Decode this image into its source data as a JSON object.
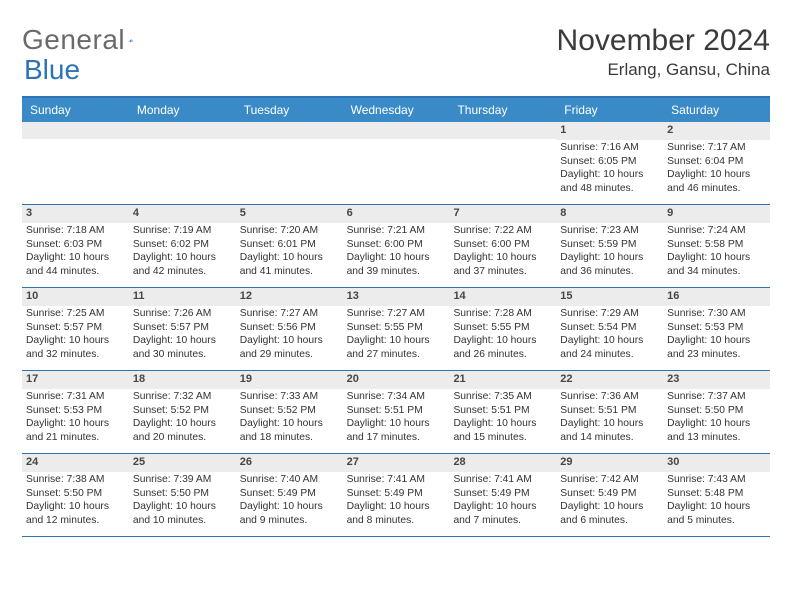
{
  "brand": {
    "part1": "General",
    "part2": "Blue"
  },
  "title": "November 2024",
  "location": "Erlang, Gansu, China",
  "weekdays": [
    "Sunday",
    "Monday",
    "Tuesday",
    "Wednesday",
    "Thursday",
    "Friday",
    "Saturday"
  ],
  "weeks": [
    [
      null,
      null,
      null,
      null,
      null,
      {
        "n": "1",
        "sr": "Sunrise: 7:16 AM",
        "ss": "Sunset: 6:05 PM",
        "dl1": "Daylight: 10 hours",
        "dl2": "and 48 minutes."
      },
      {
        "n": "2",
        "sr": "Sunrise: 7:17 AM",
        "ss": "Sunset: 6:04 PM",
        "dl1": "Daylight: 10 hours",
        "dl2": "and 46 minutes."
      }
    ],
    [
      {
        "n": "3",
        "sr": "Sunrise: 7:18 AM",
        "ss": "Sunset: 6:03 PM",
        "dl1": "Daylight: 10 hours",
        "dl2": "and 44 minutes."
      },
      {
        "n": "4",
        "sr": "Sunrise: 7:19 AM",
        "ss": "Sunset: 6:02 PM",
        "dl1": "Daylight: 10 hours",
        "dl2": "and 42 minutes."
      },
      {
        "n": "5",
        "sr": "Sunrise: 7:20 AM",
        "ss": "Sunset: 6:01 PM",
        "dl1": "Daylight: 10 hours",
        "dl2": "and 41 minutes."
      },
      {
        "n": "6",
        "sr": "Sunrise: 7:21 AM",
        "ss": "Sunset: 6:00 PM",
        "dl1": "Daylight: 10 hours",
        "dl2": "and 39 minutes."
      },
      {
        "n": "7",
        "sr": "Sunrise: 7:22 AM",
        "ss": "Sunset: 6:00 PM",
        "dl1": "Daylight: 10 hours",
        "dl2": "and 37 minutes."
      },
      {
        "n": "8",
        "sr": "Sunrise: 7:23 AM",
        "ss": "Sunset: 5:59 PM",
        "dl1": "Daylight: 10 hours",
        "dl2": "and 36 minutes."
      },
      {
        "n": "9",
        "sr": "Sunrise: 7:24 AM",
        "ss": "Sunset: 5:58 PM",
        "dl1": "Daylight: 10 hours",
        "dl2": "and 34 minutes."
      }
    ],
    [
      {
        "n": "10",
        "sr": "Sunrise: 7:25 AM",
        "ss": "Sunset: 5:57 PM",
        "dl1": "Daylight: 10 hours",
        "dl2": "and 32 minutes."
      },
      {
        "n": "11",
        "sr": "Sunrise: 7:26 AM",
        "ss": "Sunset: 5:57 PM",
        "dl1": "Daylight: 10 hours",
        "dl2": "and 30 minutes."
      },
      {
        "n": "12",
        "sr": "Sunrise: 7:27 AM",
        "ss": "Sunset: 5:56 PM",
        "dl1": "Daylight: 10 hours",
        "dl2": "and 29 minutes."
      },
      {
        "n": "13",
        "sr": "Sunrise: 7:27 AM",
        "ss": "Sunset: 5:55 PM",
        "dl1": "Daylight: 10 hours",
        "dl2": "and 27 minutes."
      },
      {
        "n": "14",
        "sr": "Sunrise: 7:28 AM",
        "ss": "Sunset: 5:55 PM",
        "dl1": "Daylight: 10 hours",
        "dl2": "and 26 minutes."
      },
      {
        "n": "15",
        "sr": "Sunrise: 7:29 AM",
        "ss": "Sunset: 5:54 PM",
        "dl1": "Daylight: 10 hours",
        "dl2": "and 24 minutes."
      },
      {
        "n": "16",
        "sr": "Sunrise: 7:30 AM",
        "ss": "Sunset: 5:53 PM",
        "dl1": "Daylight: 10 hours",
        "dl2": "and 23 minutes."
      }
    ],
    [
      {
        "n": "17",
        "sr": "Sunrise: 7:31 AM",
        "ss": "Sunset: 5:53 PM",
        "dl1": "Daylight: 10 hours",
        "dl2": "and 21 minutes."
      },
      {
        "n": "18",
        "sr": "Sunrise: 7:32 AM",
        "ss": "Sunset: 5:52 PM",
        "dl1": "Daylight: 10 hours",
        "dl2": "and 20 minutes."
      },
      {
        "n": "19",
        "sr": "Sunrise: 7:33 AM",
        "ss": "Sunset: 5:52 PM",
        "dl1": "Daylight: 10 hours",
        "dl2": "and 18 minutes."
      },
      {
        "n": "20",
        "sr": "Sunrise: 7:34 AM",
        "ss": "Sunset: 5:51 PM",
        "dl1": "Daylight: 10 hours",
        "dl2": "and 17 minutes."
      },
      {
        "n": "21",
        "sr": "Sunrise: 7:35 AM",
        "ss": "Sunset: 5:51 PM",
        "dl1": "Daylight: 10 hours",
        "dl2": "and 15 minutes."
      },
      {
        "n": "22",
        "sr": "Sunrise: 7:36 AM",
        "ss": "Sunset: 5:51 PM",
        "dl1": "Daylight: 10 hours",
        "dl2": "and 14 minutes."
      },
      {
        "n": "23",
        "sr": "Sunrise: 7:37 AM",
        "ss": "Sunset: 5:50 PM",
        "dl1": "Daylight: 10 hours",
        "dl2": "and 13 minutes."
      }
    ],
    [
      {
        "n": "24",
        "sr": "Sunrise: 7:38 AM",
        "ss": "Sunset: 5:50 PM",
        "dl1": "Daylight: 10 hours",
        "dl2": "and 12 minutes."
      },
      {
        "n": "25",
        "sr": "Sunrise: 7:39 AM",
        "ss": "Sunset: 5:50 PM",
        "dl1": "Daylight: 10 hours",
        "dl2": "and 10 minutes."
      },
      {
        "n": "26",
        "sr": "Sunrise: 7:40 AM",
        "ss": "Sunset: 5:49 PM",
        "dl1": "Daylight: 10 hours",
        "dl2": "and 9 minutes."
      },
      {
        "n": "27",
        "sr": "Sunrise: 7:41 AM",
        "ss": "Sunset: 5:49 PM",
        "dl1": "Daylight: 10 hours",
        "dl2": "and 8 minutes."
      },
      {
        "n": "28",
        "sr": "Sunrise: 7:41 AM",
        "ss": "Sunset: 5:49 PM",
        "dl1": "Daylight: 10 hours",
        "dl2": "and 7 minutes."
      },
      {
        "n": "29",
        "sr": "Sunrise: 7:42 AM",
        "ss": "Sunset: 5:49 PM",
        "dl1": "Daylight: 10 hours",
        "dl2": "and 6 minutes."
      },
      {
        "n": "30",
        "sr": "Sunrise: 7:43 AM",
        "ss": "Sunset: 5:48 PM",
        "dl1": "Daylight: 10 hours",
        "dl2": "and 5 minutes."
      }
    ]
  ]
}
